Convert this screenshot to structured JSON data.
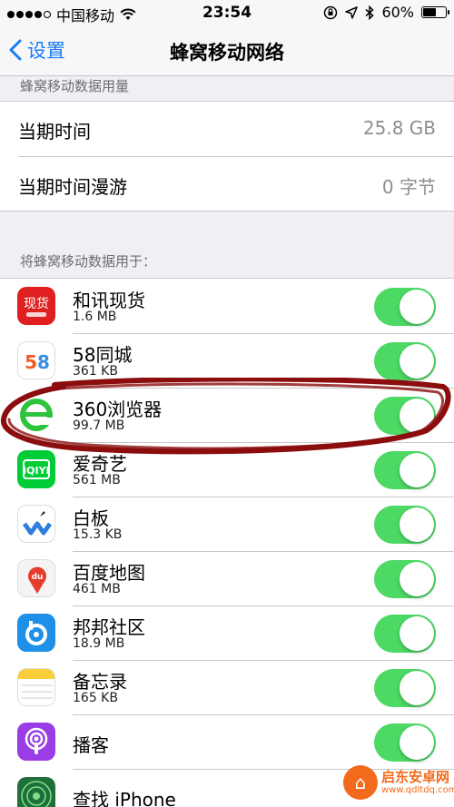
{
  "status_bar": {
    "carrier": "中国移动",
    "time": "23:54",
    "battery": "60%",
    "battery_level": 0.6,
    "signal_bars": 4,
    "icons": [
      "wifi-icon",
      "orientation-lock-icon",
      "location-icon",
      "bluetooth-icon",
      "battery-icon"
    ]
  },
  "nav": {
    "back_label": "设置",
    "title": "蜂窝移动网络"
  },
  "usage": {
    "header": "蜂窝移动数据用量",
    "rows": [
      {
        "label": "当期时间",
        "value": "25.8 GB"
      },
      {
        "label": "当期时间漫游",
        "value": "0 字节"
      }
    ]
  },
  "apps": {
    "header": "将蜂窝移动数据用于：",
    "items": [
      {
        "name": "和讯现货",
        "size": "1.6 MB",
        "icon": "hexun-app-icon",
        "enabled": true
      },
      {
        "name": "58同城",
        "size": "361 KB",
        "icon": "58tongcheng-app-icon",
        "enabled": true
      },
      {
        "name": "360浏览器",
        "size": "99.7 MB",
        "icon": "360-browser-app-icon",
        "enabled": true
      },
      {
        "name": "爱奇艺",
        "size": "561 MB",
        "icon": "iqiyi-app-icon",
        "enabled": true
      },
      {
        "name": "白板",
        "size": "15.3 KB",
        "icon": "whiteboard-app-icon",
        "enabled": true
      },
      {
        "name": "百度地图",
        "size": "461 MB",
        "icon": "baidu-map-app-icon",
        "enabled": true
      },
      {
        "name": "邦邦社区",
        "size": "18.9 MB",
        "icon": "bangbang-app-icon",
        "enabled": true
      },
      {
        "name": "备忘录",
        "size": "165 KB",
        "icon": "notes-app-icon",
        "enabled": true
      },
      {
        "name": "播客",
        "size": "",
        "icon": "podcasts-app-icon",
        "enabled": true
      },
      {
        "name": "查找 iPhone",
        "size": "",
        "icon": "find-iphone-app-icon",
        "enabled": true
      }
    ]
  },
  "colors": {
    "accent": "#1a7cf3",
    "toggle_on": "#4cd964",
    "annotation": "#8b0d0d",
    "watermark": "#f26b1d"
  },
  "watermark": {
    "text": "启东安卓网",
    "url": "www.qdltdq.com"
  }
}
